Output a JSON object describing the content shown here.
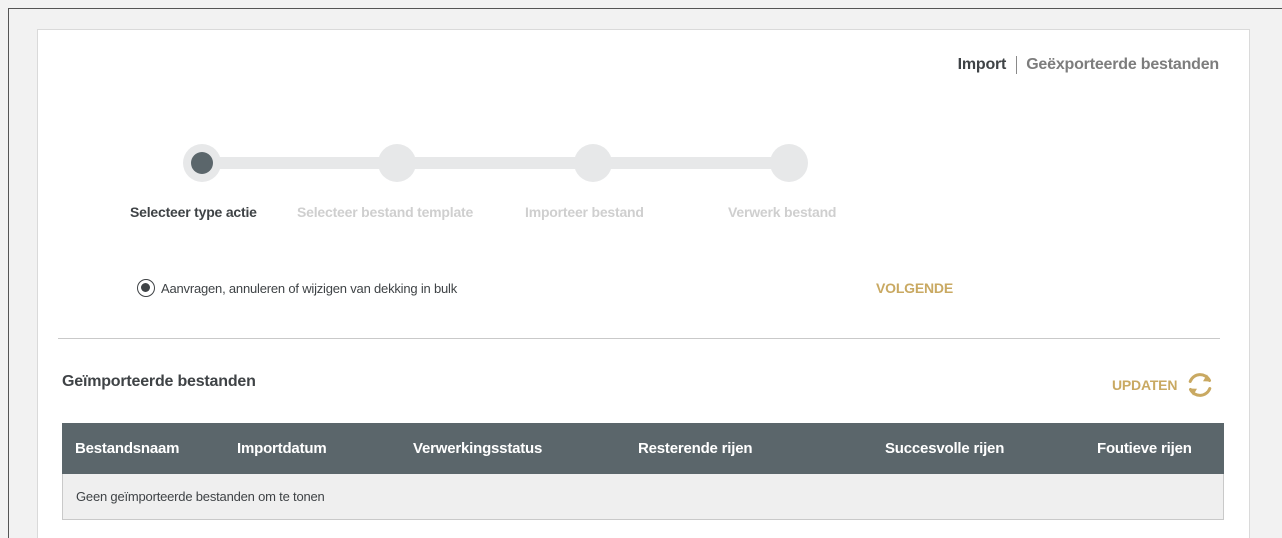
{
  "nav": {
    "import_label": "Import",
    "exported_label": "Geëxporteerde bestanden"
  },
  "stepper": {
    "steps": [
      {
        "label": "Selecteer type actie",
        "state": "active"
      },
      {
        "label": "Selecteer bestand template",
        "state": "inactive"
      },
      {
        "label": "Importeer bestand",
        "state": "inactive"
      },
      {
        "label": "Verwerk bestand",
        "state": "inactive"
      }
    ]
  },
  "action": {
    "option_label": "Aanvragen, annuleren of wijzigen van dekking in bulk",
    "option_selected": true,
    "next_label": "VOLGENDE"
  },
  "imported": {
    "title": "Geïmporteerde bestanden",
    "update_label": "UPDATEN",
    "columns": [
      "Bestandsnaam",
      "Importdatum",
      "Verwerkingsstatus",
      "Resterende rijen",
      "Succesvolle rijen",
      "Foutieve rijen"
    ],
    "empty_message": "Geen geïmporteerde bestanden om te tonen"
  },
  "colors": {
    "accent": "#c9a962",
    "header_bg": "#5b666b",
    "text_dark": "#3f4346",
    "inactive": "#cfcfcf"
  }
}
